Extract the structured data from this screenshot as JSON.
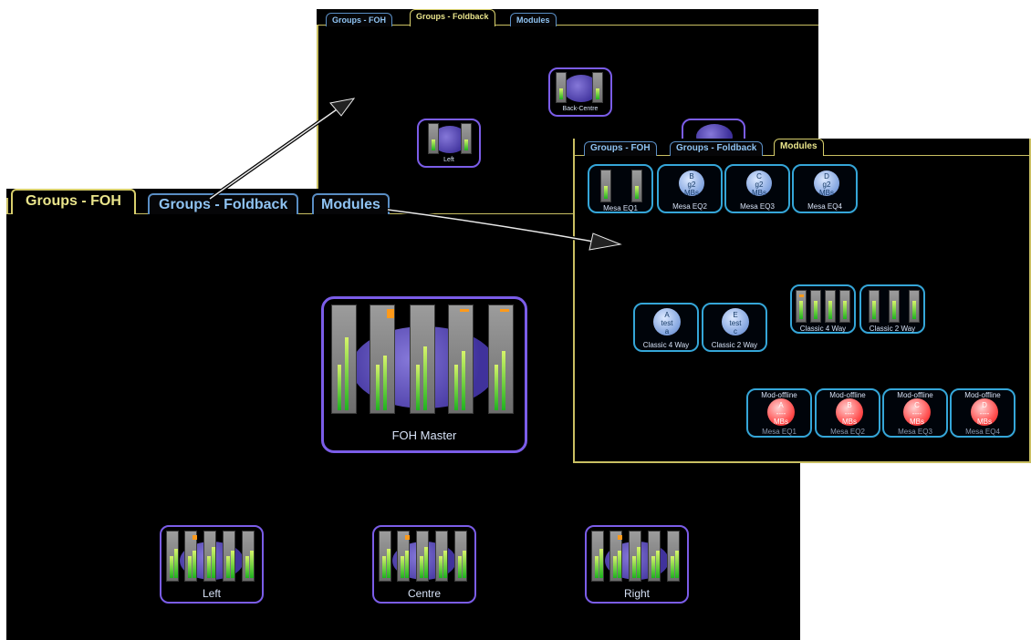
{
  "back_panel": {
    "tabs": [
      "Groups - FOH",
      "Groups - Foldback",
      "Modules"
    ],
    "nodes": [
      "Back-Centre",
      "Left"
    ]
  },
  "main_panel": {
    "tabs": [
      "Groups - FOH",
      "Groups - Foldback",
      "Modules"
    ],
    "master_label": "FOH Master",
    "groups": [
      "Left",
      "Centre",
      "Right"
    ]
  },
  "modules_panel": {
    "tabs": [
      "Groups - FOH",
      "Groups - Foldback",
      "Modules"
    ],
    "row1": [
      {
        "label": "Mesa EQ1"
      },
      {
        "label": "Mesa EQ2",
        "knob": [
          "B",
          "g2",
          "MBs"
        ]
      },
      {
        "label": "Mesa EQ3",
        "knob": [
          "C",
          "g2",
          "MBs"
        ]
      },
      {
        "label": "Mesa EQ4",
        "knob": [
          "D",
          "g2",
          "MBs"
        ]
      }
    ],
    "classic_knobs": [
      {
        "label": "Classic 4 Way",
        "knob": [
          "A",
          "test",
          "a"
        ]
      },
      {
        "label": "Classic 2 Way",
        "knob": [
          "E",
          "test",
          "c"
        ]
      }
    ],
    "classic_meters": [
      "Classic 4 Way",
      "Classic 2 Way"
    ],
    "red_modules": [
      {
        "title": "Mod-offline",
        "label": "Mesa EQ1",
        "knob": [
          "A",
          "----",
          "MBs"
        ]
      },
      {
        "title": "Mod-offline",
        "label": "Mesa EQ2",
        "knob": [
          "B",
          "----",
          "MBs"
        ]
      },
      {
        "title": "Mod-offline",
        "label": "Mesa EQ3",
        "knob": [
          "C",
          "----",
          "MBs"
        ]
      },
      {
        "title": "Mod-offline",
        "label": "Mesa EQ4",
        "knob": [
          "D",
          "----",
          "MBs"
        ]
      }
    ]
  },
  "colors": {
    "active_tab": "#e9e48b",
    "inactive_tab": "#8fc3f2",
    "group_border": "#7b5de8",
    "module_border": "#35a6d8"
  },
  "icons": [
    "level-meter-icon",
    "knob-icon",
    "arrow-icon"
  ]
}
